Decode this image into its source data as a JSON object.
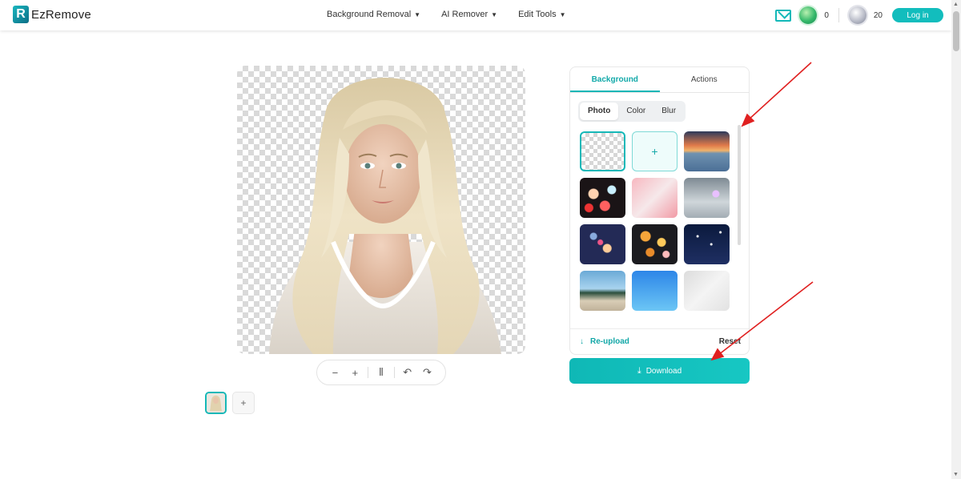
{
  "header": {
    "logo_mark": "R",
    "logo_text": "EzRemove",
    "nav": [
      {
        "label": "Background Removal"
      },
      {
        "label": "AI Remover"
      },
      {
        "label": "Edit Tools"
      }
    ],
    "caret": "▼",
    "green_count": "0",
    "silver_count": "20",
    "login_label": "Log in"
  },
  "toolbar": {
    "zoom_out": "−",
    "zoom_in": "+",
    "compare": "⫴",
    "undo": "↶",
    "redo": "↷"
  },
  "thumbs": {
    "add": "+"
  },
  "panel": {
    "tabs": [
      {
        "label": "Background",
        "active": true
      },
      {
        "label": "Actions",
        "active": false
      }
    ],
    "segments": [
      {
        "label": "Photo",
        "active": true
      },
      {
        "label": "Color",
        "active": false
      },
      {
        "label": "Blur",
        "active": false
      }
    ],
    "grid_add": "+",
    "reupload_icon": "↓",
    "reupload_label": "Re-upload",
    "reset_label": "Reset"
  },
  "download": {
    "icon": "⤓",
    "label": "Download"
  },
  "colors": {
    "accent": "#12b8b8",
    "annotation_arrow": "#e02020"
  }
}
